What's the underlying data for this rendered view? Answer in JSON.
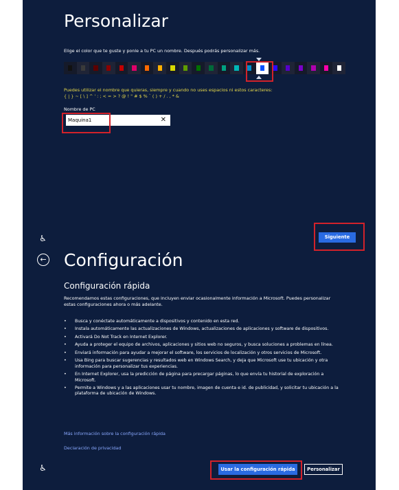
{
  "personalize": {
    "title": "Personalizar",
    "subtitle": "Elige el color que te guste y ponle a tu PC un nombre. Después podrás personalizar más.",
    "colors": [
      "#111111",
      "#3a3a3a",
      "#5c0000",
      "#8b0000",
      "#c40000",
      "#e0006a",
      "#ff6a00",
      "#ffb000",
      "#d8d800",
      "#5f9c00",
      "#007000",
      "#006a3a",
      "#00a080",
      "#00b6b6",
      "#008cc8",
      "#0050ff",
      "#2a0aff",
      "#5600c8",
      "#7a00c8",
      "#b000b0",
      "#ff00aa",
      "#ffffff"
    ],
    "selected_color_index": 15,
    "name_rules_line1": "Puedes utilizar el nombre que quieras, siempre y cuando no uses espacios ni estos caracteres:",
    "name_rules_line2": "{ | } ~ [ \\ ] ^ ' : ; < = > ? @ ! \" # $ % ` ( ) + / . , * &",
    "pc_name_label": "Nombre de PC",
    "pc_name_value": "Maquina1",
    "clear_glyph": "✕",
    "next_button": "Siguiente",
    "accessibility_glyph": "♿"
  },
  "settings": {
    "back_glyph": "←",
    "title": "Configuración",
    "section_title": "Configuración rápida",
    "intro": "Recomendamos estas configuraciones, que incluyen enviar ocasionalmente información a Microsoft. Puedes personalizar estas configuraciones ahora o más adelante.",
    "bullets": [
      "Busca y conéctate automáticamente a dispositivos y contenido en esta red.",
      "Instala automáticamente las actualizaciones de Windows, actualizaciones de aplicaciones y software de dispositivos.",
      "Activará Do Not Track en Internet Explorer.",
      "Ayuda a proteger el equipo de archivos, aplicaciones y sitios web no seguros, y busca soluciones a problemas en línea.",
      "Enviará información para ayudar a mejorar el software, los servicios de localización y otros servicios de Microsoft.",
      "Usa Bing para buscar sugerencias y resultados web en Windows Search, y deja que Microsoft use tu ubicación y otra información para personalizar tus experiencias.",
      "En Internet Explorer, usa la predicción de página para precargar páginas, lo que envía tu historial de exploración a Microsoft.",
      "Permite a Windows y a las aplicaciones usar tu nombre, imagen de cuenta e id. de publicidad, y solicitar tu ubicación a la plataforma de ubicación de Windows."
    ],
    "link_more": "Más información sobre la configuración rápida",
    "link_privacy": "Declaración de privacidad",
    "express_button": "Usar la configuración rápida",
    "customize_button": "Personalizar",
    "accessibility_glyph": "♿"
  },
  "theme": {
    "background": "#0d1d3d",
    "accent": "#2a6be2",
    "rules_text": "#e6d84a",
    "link": "#8aa9ff",
    "highlight": "#d3222a"
  }
}
